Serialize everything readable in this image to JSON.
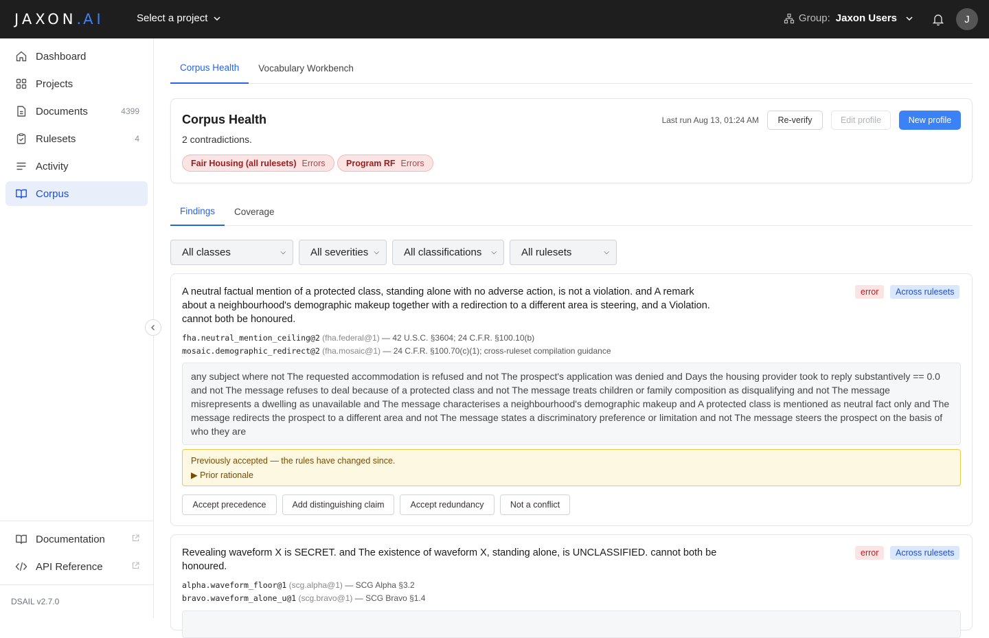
{
  "topbar": {
    "logo_text": "JAXON",
    "logo_dot": ".",
    "logo_ai": "AI",
    "project_select": "Select a project",
    "group_label": "Group:",
    "group_name": "Jaxon Users",
    "avatar_initial": "J"
  },
  "sidebar": {
    "items": [
      {
        "label": "Dashboard",
        "icon": "home-icon"
      },
      {
        "label": "Projects",
        "icon": "grid-icon"
      },
      {
        "label": "Documents",
        "icon": "document-icon",
        "count": "4399"
      },
      {
        "label": "Rulesets",
        "icon": "clipboard-check-icon",
        "count": "4"
      },
      {
        "label": "Activity",
        "icon": "lines-icon"
      },
      {
        "label": "Corpus",
        "icon": "book-icon",
        "active": true
      }
    ],
    "footer_links": [
      {
        "label": "Documentation",
        "icon": "book-icon"
      },
      {
        "label": "API Reference",
        "icon": "code-icon"
      }
    ],
    "version": "DSAIL v2.7.0"
  },
  "tabs": [
    "Corpus Health",
    "Vocabulary Workbench"
  ],
  "health": {
    "title": "Corpus Health",
    "subtitle": "2 contradictions.",
    "last_run": "Last run Aug 13, 01:24 AM",
    "buttons": {
      "reverify": "Re-verify",
      "edit": "Edit profile",
      "new": "New profile"
    },
    "pills": [
      {
        "name": "Fair Housing (all rulesets)",
        "status": "Errors"
      },
      {
        "name": "Program RF",
        "status": "Errors"
      }
    ]
  },
  "subtabs": [
    "Findings",
    "Coverage"
  ],
  "filters": [
    "All classes",
    "All severities",
    "All classifications",
    "All rulesets"
  ],
  "findings": [
    {
      "title": "A neutral factual mention of a protected class, standing alone with no adverse action, is not a violation. and A remark about a neighbourhood's demographic makeup together with a redirection to a different area is steering, and a Violation. cannot both be honoured.",
      "severity": "error",
      "scope": "Across rulesets",
      "refs": [
        {
          "id": "fha.neutral_mention_ceiling@2",
          "src": "(fha.federal@1)",
          "cite": "— 42 U.S.C. §3604; 24 C.F.R. §100.10(b)"
        },
        {
          "id": "mosaic.demographic_redirect@2",
          "src": "(fha.mosaic@1)",
          "cite": "— 24 C.F.R. §100.70(c)(1); cross-ruleset compilation guidance"
        }
      ],
      "condition": "any subject where not The requested accommodation is refused and not The prospect's application was denied and Days the housing provider took to reply substantively == 0.0 and not The message refuses to deal because of a protected class and not The message treats children or family composition as disqualifying and not The message misrepresents a dwelling as unavailable and The message characterises a neighbourhood's demographic makeup and A protected class is mentioned as neutral fact only and The message redirects the prospect to a different area and not The message states a discriminatory preference or limitation and not The message steers the prospect on the basis of who they are",
      "warning": "Previously accepted — the rules have changed since.",
      "prior": "▶ Prior rationale",
      "actions": [
        "Accept precedence",
        "Add distinguishing claim",
        "Accept redundancy",
        "Not a conflict"
      ]
    },
    {
      "title": "Revealing waveform X is SECRET. and The existence of waveform X, standing alone, is UNCLASSIFIED. cannot both be honoured.",
      "severity": "error",
      "scope": "Across rulesets",
      "refs": [
        {
          "id": "alpha.waveform_floor@1",
          "src": "(scg.alpha@1)",
          "cite": "— SCG Alpha §3.2"
        },
        {
          "id": "bravo.waveform_alone_u@1",
          "src": "(scg.bravo@1)",
          "cite": "— SCG Bravo §1.4"
        }
      ]
    }
  ],
  "colors": {
    "topbar": "#1e1e1e",
    "accent": "#3b82f6",
    "error_bg": "#fde4e4",
    "warn_bg": "#fdf8e1"
  }
}
